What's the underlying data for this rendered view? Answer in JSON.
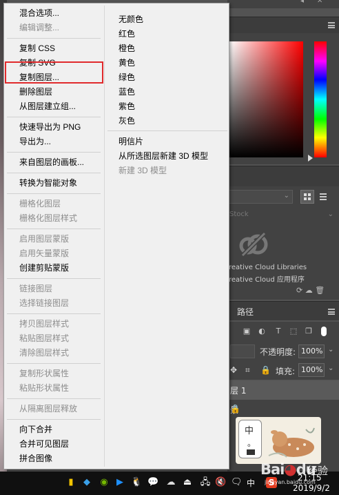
{
  "context_menu": {
    "left_items": [
      {
        "label": "混合选项...",
        "enabled": true
      },
      {
        "label": "编辑调整...",
        "enabled": false
      },
      {
        "label": "复制 CSS",
        "enabled": true
      },
      {
        "label": "复制 SVG",
        "enabled": true
      },
      {
        "label": "复制图层...",
        "enabled": true,
        "highlighted": true
      },
      {
        "label": "删除图层",
        "enabled": true
      },
      {
        "label": "从图层建立组...",
        "enabled": true
      },
      {
        "label": "快速导出为 PNG",
        "enabled": true
      },
      {
        "label": "导出为...",
        "enabled": true
      },
      {
        "label": "来自图层的画板...",
        "enabled": true
      },
      {
        "label": "转换为智能对象",
        "enabled": true
      },
      {
        "label": "栅格化图层",
        "enabled": false
      },
      {
        "label": "栅格化图层样式",
        "enabled": false
      },
      {
        "label": "启用图层蒙版",
        "enabled": false
      },
      {
        "label": "启用矢量蒙版",
        "enabled": false
      },
      {
        "label": "创建剪贴蒙版",
        "enabled": true
      },
      {
        "label": "链接图层",
        "enabled": false
      },
      {
        "label": "选择链接图层",
        "enabled": false
      },
      {
        "label": "拷贝图层样式",
        "enabled": false
      },
      {
        "label": "粘贴图层样式",
        "enabled": false
      },
      {
        "label": "清除图层样式",
        "enabled": false
      },
      {
        "label": "复制形状属性",
        "enabled": false
      },
      {
        "label": "粘贴形状属性",
        "enabled": false
      },
      {
        "label": "从隔离图层释放",
        "enabled": false
      },
      {
        "label": "向下合并",
        "enabled": true
      },
      {
        "label": "合并可见图层",
        "enabled": true
      },
      {
        "label": "拼合图像",
        "enabled": true
      }
    ],
    "right_items": [
      {
        "label": "无颜色",
        "enabled": true
      },
      {
        "label": "红色",
        "enabled": true
      },
      {
        "label": "橙色",
        "enabled": true
      },
      {
        "label": "黄色",
        "enabled": true
      },
      {
        "label": "绿色",
        "enabled": true
      },
      {
        "label": "蓝色",
        "enabled": true
      },
      {
        "label": "紫色",
        "enabled": true
      },
      {
        "label": "灰色",
        "enabled": true
      },
      {
        "label": "明信片",
        "enabled": true
      },
      {
        "label": "从所选图层新建 3D 模型",
        "enabled": true
      },
      {
        "label": "新建 3D 模型",
        "enabled": false
      }
    ]
  },
  "libraries_panel": {
    "search_placeholder": "Stock",
    "cc_line1": "reative Cloud Libraries",
    "cc_line2": "reative Cloud 应用程序"
  },
  "layers_panel": {
    "tab_paths": "路径",
    "opacity_label": "不透明度:",
    "opacity_value": "100%",
    "fill_label": "填充:",
    "fill_value": "100%",
    "layer_1": "层 1",
    "layer_bg": "景"
  },
  "sticker": {
    "char": "中",
    "dot": "。"
  },
  "taskbar": {
    "ime": "中",
    "s_badge": "S",
    "time": "21:15",
    "date": "2019/9/2"
  },
  "watermark": {
    "brand_a": "Bai",
    "brand_b": "du",
    "brand_cn": "经验",
    "url": "jingyan.baidu.com"
  },
  "colors": {
    "menu_bg": "#f0f0f0",
    "highlight_border": "#e0292b",
    "panel_bg": "#424242",
    "taskbar_bg": "#101010"
  }
}
